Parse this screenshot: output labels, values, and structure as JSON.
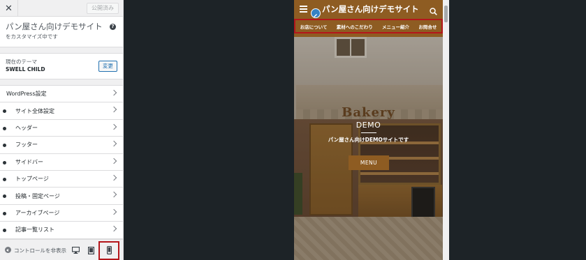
{
  "customizer": {
    "close_symbol": "✕",
    "publish_label": "公開済み",
    "site_title": "パン屋さん向けデモサイト",
    "customizing_text": "をカスタマイズ中です",
    "help_symbol": "?",
    "theme": {
      "label": "現在のテーマ",
      "name": "SWELL CHILD",
      "change_label": "変更"
    },
    "menu_items": [
      {
        "label": "WordPress設定"
      },
      {
        "label": "サイト全体設定"
      },
      {
        "label": "ヘッダー"
      },
      {
        "label": "フッター"
      },
      {
        "label": "サイドバー"
      },
      {
        "label": "トップページ"
      },
      {
        "label": "投稿・固定ページ"
      },
      {
        "label": "アーカイブページ"
      },
      {
        "label": "記事一覧リスト"
      }
    ],
    "footer": {
      "hide_controls_label": "コントロールを非表示",
      "device_icons": [
        "desktop-icon",
        "tablet-icon",
        "mobile-icon"
      ]
    }
  },
  "preview": {
    "site_name": "パン屋さん向けデモサイト",
    "nav": [
      "お店について",
      "素材へのこだわり",
      "メニュー紹介",
      "お問合せ"
    ],
    "hero": {
      "sign_text": "Bakery",
      "demo_text": "DEMO",
      "tagline": "パン屋さん向けDEMOサイトです",
      "button_label": "MENU"
    },
    "colors": {
      "header_bg": "#8e5c22",
      "highlight_border": "#b4161b",
      "sidebar_bg": "#f0f0f1",
      "canvas_bg": "#1d2327"
    }
  }
}
